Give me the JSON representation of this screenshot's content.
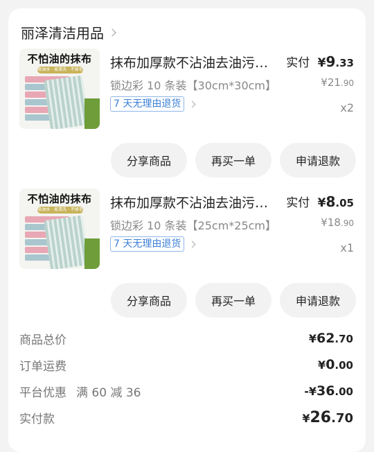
{
  "shop": {
    "name": "丽泽清洁用品"
  },
  "items": [
    {
      "thumb_title": "不怕油的抹布",
      "thumb_tag": "吸油水 · 易清洗 · 不掉毛",
      "title": "抹布加厚款不沾油去油污吸水厨房用品",
      "spec": "锁边彩 10 条装【30cm*30cm】",
      "policy": "7 天无理由退货",
      "pay_label": "实付",
      "pay_currency": "¥",
      "pay_int": "9",
      "pay_dec": ".33",
      "orig_currency": "¥",
      "orig_int": "21",
      "orig_dec": ".90",
      "qty": "x2",
      "buttons": [
        "分享商品",
        "再买一单",
        "申请退款"
      ]
    },
    {
      "thumb_title": "不怕油的抹布",
      "thumb_tag": "吸油水 · 易清洗 · 不掉毛",
      "title": "抹布加厚款不沾油去油污吸水厨房用品",
      "spec": "锁边彩 10 条装【25cm*25cm】",
      "policy": "7 天无理由退货",
      "pay_label": "实付",
      "pay_currency": "¥",
      "pay_int": "8",
      "pay_dec": ".05",
      "orig_currency": "¥",
      "orig_int": "18",
      "orig_dec": ".90",
      "qty": "x1",
      "buttons": [
        "分享商品",
        "再买一单",
        "申请退款"
      ]
    }
  ],
  "summary": {
    "goods_total": {
      "label": "商品总价",
      "prefix": "¥",
      "int": "62",
      "dec": ".70"
    },
    "shipping": {
      "label": "订单运费",
      "prefix": "¥",
      "int": "0",
      "dec": ".00"
    },
    "discount": {
      "label": "平台优惠",
      "promo": "满 60 减 36",
      "prefix": "-¥",
      "int": "36",
      "dec": ".00"
    },
    "paid": {
      "label": "实付款",
      "prefix": "¥",
      "int": "26",
      "dec": ".70"
    }
  },
  "colors": {
    "policy_blue": "#3b7fd6",
    "card_bg": "#ffffff",
    "page_bg": "#f3f3f3"
  }
}
